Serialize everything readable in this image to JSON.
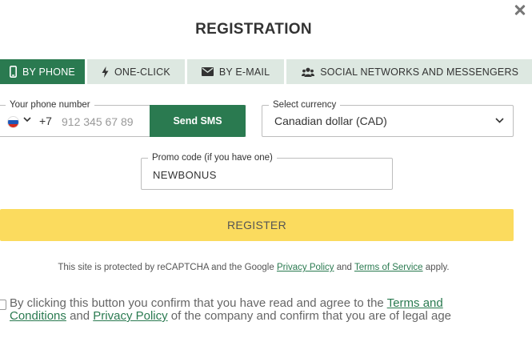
{
  "dialog": {
    "title": "REGISTRATION"
  },
  "tabs": [
    {
      "label": "BY PHONE",
      "icon": "phone-icon",
      "active": true
    },
    {
      "label": "ONE-CLICK",
      "icon": "lightning-icon",
      "active": false
    },
    {
      "label": "BY E-MAIL",
      "icon": "envelope-icon",
      "active": false
    },
    {
      "label": "SOCIAL NETWORKS AND MESSENGERS",
      "icon": "users-icon",
      "active": false
    }
  ],
  "phone": {
    "label": "Your phone number",
    "country_flag": "russia-flag-icon",
    "dial_code": "+7",
    "placeholder": "912 345 67 89",
    "value": "",
    "send_button": "Send SMS"
  },
  "currency": {
    "label": "Select currency",
    "value": "Canadian dollar (CAD)"
  },
  "promo": {
    "label": "Promo code (if you have one)",
    "value": "NEWBONUS"
  },
  "register_button": "REGISTER",
  "recaptcha": {
    "prefix": "This site is protected by reCAPTCHA and the Google",
    "privacy_link": "Privacy Policy",
    "and": "and",
    "terms_link": "Terms of Service",
    "suffix": "apply."
  },
  "agreement": {
    "checked": false,
    "prefix": "By clicking this button you confirm that you have read and agree to the",
    "terms_link": "Terms and Conditions",
    "and": "and",
    "privacy_link": "Privacy Policy",
    "suffix": "of the company and confirm that you are of legal age"
  },
  "colors": {
    "primary_green": "#2a7a50",
    "tab_inactive": "#dde8e1",
    "register_yellow": "#fbdb5e"
  }
}
